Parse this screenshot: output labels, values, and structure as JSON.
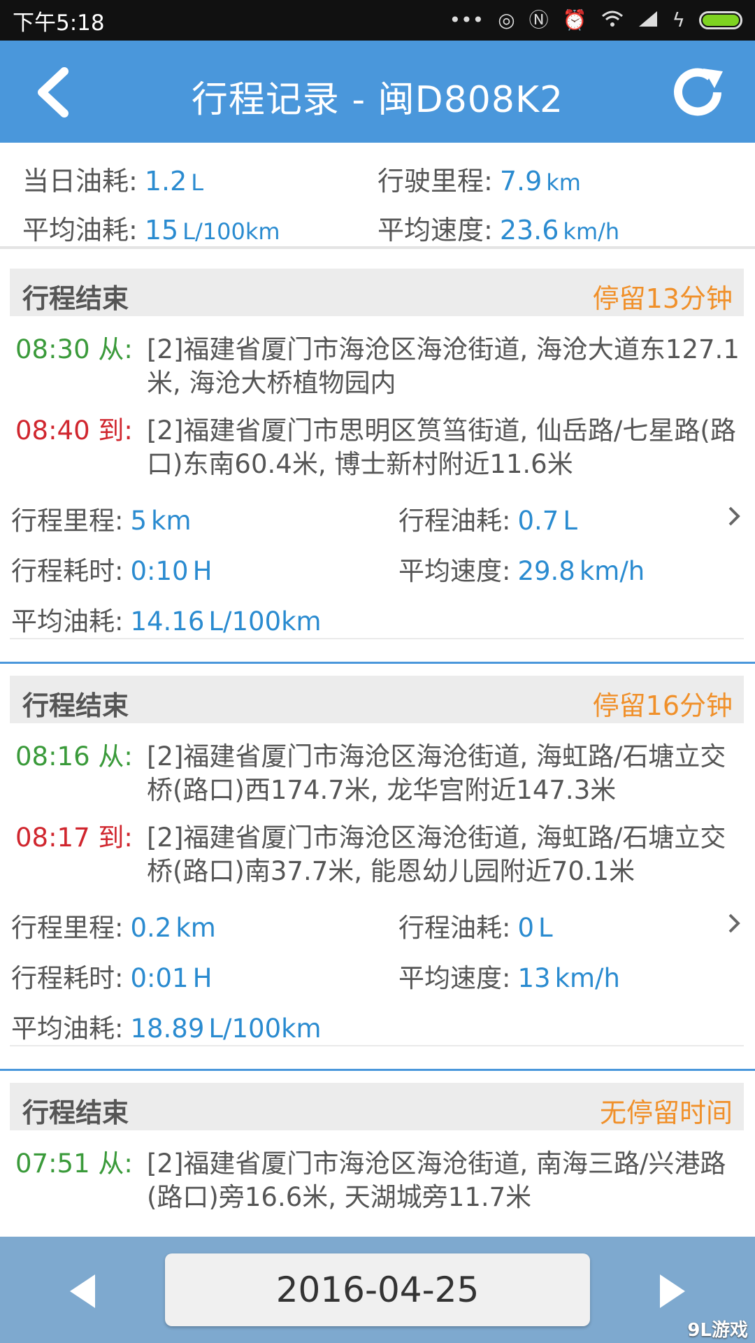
{
  "status_bar": {
    "time": "下午5:18",
    "icons": [
      "more-icon",
      "hotspot-icon",
      "nfc-icon",
      "alarm-icon",
      "wifi-icon",
      "signal-icon",
      "charging-icon",
      "battery-icon"
    ]
  },
  "header": {
    "title": "行程记录 - 闽D808K2",
    "back_icon": "back-arrow-icon",
    "refresh_icon": "refresh-icon",
    "color": "#4a97db"
  },
  "summary": {
    "daily_fuel_label": "当日油耗:",
    "daily_fuel_value": "1.2",
    "daily_fuel_unit": "L",
    "mileage_label": "行驶里程:",
    "mileage_value": "7.9",
    "mileage_unit": "km",
    "avg_fuel_label": "平均油耗:",
    "avg_fuel_value": "15",
    "avg_fuel_unit": "L/100km",
    "avg_speed_label": "平均速度:",
    "avg_speed_value": "23.6",
    "avg_speed_unit": "km/h"
  },
  "trips": [
    {
      "status": "行程结束",
      "stay": "停留13分钟",
      "from_time": "08:30 从:",
      "from_addr": "[2]福建省厦门市海沧区海沧街道, 海沧大道东127.1米, 海沧大桥植物园内",
      "to_time": "08:40 到:",
      "to_addr": "[2]福建省厦门市思明区筼筜街道, 仙岳路/七星路(路口)东南60.4米, 博士新村附近11.6米",
      "distance_label": "行程里程:",
      "distance_value": "5",
      "distance_unit": "km",
      "fuel_label": "行程油耗:",
      "fuel_value": "0.7",
      "fuel_unit": "L",
      "duration_label": "行程耗时:",
      "duration_value": "0:10",
      "duration_unit": "H",
      "speed_label": "平均速度:",
      "speed_value": "29.8",
      "speed_unit": "km/h",
      "avg_fuel_label": "平均油耗:",
      "avg_fuel_value": "14.16",
      "avg_fuel_unit": "L/100km"
    },
    {
      "status": "行程结束",
      "stay": "停留16分钟",
      "from_time": "08:16 从:",
      "from_addr": "[2]福建省厦门市海沧区海沧街道, 海虹路/石塘立交桥(路口)西174.7米, 龙华宫附近147.3米",
      "to_time": "08:17 到:",
      "to_addr": "[2]福建省厦门市海沧区海沧街道, 海虹路/石塘立交桥(路口)南37.7米, 能恩幼儿园附近70.1米",
      "distance_label": "行程里程:",
      "distance_value": "0.2",
      "distance_unit": "km",
      "fuel_label": "行程油耗:",
      "fuel_value": "0",
      "fuel_unit": "L",
      "duration_label": "行程耗时:",
      "duration_value": "0:01",
      "duration_unit": "H",
      "speed_label": "平均速度:",
      "speed_value": "13",
      "speed_unit": "km/h",
      "avg_fuel_label": "平均油耗:",
      "avg_fuel_value": "18.89",
      "avg_fuel_unit": "L/100km"
    },
    {
      "status": "行程结束",
      "stay": "无停留时间",
      "from_time": "07:51 从:",
      "from_addr": "[2]福建省厦门市海沧区海沧街道, 南海三路/兴港路(路口)旁16.6米, 天湖城旁11.7米"
    }
  ],
  "bottom_bar": {
    "date": "2016-04-25",
    "prev_icon": "prev-day-icon",
    "next_icon": "next-day-icon"
  },
  "watermark": "9L游戏"
}
